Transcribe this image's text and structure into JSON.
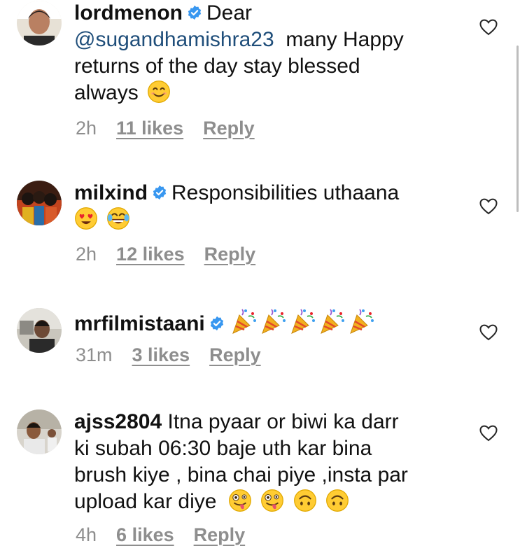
{
  "comments": [
    {
      "username": "lordmenon",
      "text_before": "Dear",
      "mention": "@sugandhamishra23",
      "text_lines": [
        "many Happy",
        "returns of the day stay blessed",
        "always"
      ],
      "emoji": [
        "smiling-face"
      ],
      "time": "2h",
      "likes": "11 likes",
      "reply": "Reply"
    },
    {
      "username": "milxind",
      "text": "Responsibilities uthaana",
      "emoji": [
        "heart-eyes-face",
        "tears-of-joy-face"
      ],
      "time": "2h",
      "likes": "12 likes",
      "reply": "Reply"
    },
    {
      "username": "mrfilmistaani",
      "emoji": [
        "party-popper",
        "party-popper",
        "party-popper",
        "party-popper",
        "party-popper"
      ],
      "time": "31m",
      "likes": "3 likes",
      "reply": "Reply"
    },
    {
      "username": "ajss2804",
      "text_lines": [
        "Itna pyaar or biwi ka darr",
        "ki subah 06:30 baje uth kar bina",
        "brush kiye , bina chai piye ,insta par",
        "upload kar diye"
      ],
      "emoji": [
        "zany-face",
        "zany-face",
        "upside-down-face",
        "upside-down-face"
      ],
      "time": "4h",
      "likes": "6 likes",
      "reply": "Reply"
    }
  ],
  "colors": {
    "verified_badge": "#3897f0",
    "mention": "#1f4e7a",
    "meta_text": "#8e8e8e"
  }
}
